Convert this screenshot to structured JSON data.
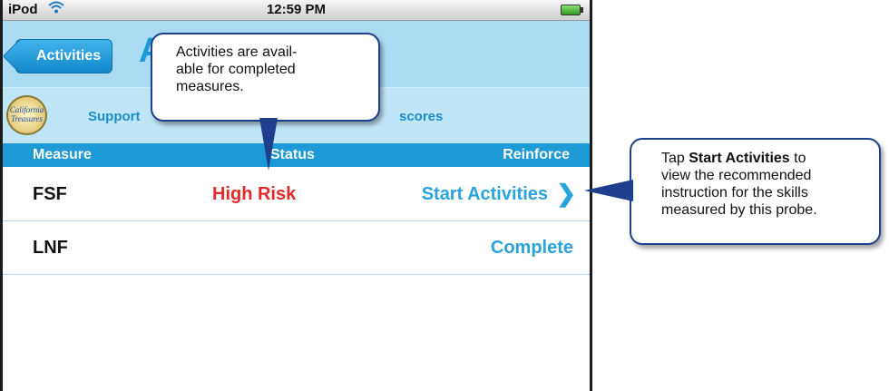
{
  "status_bar": {
    "carrier": "iPod",
    "time": "12:59 PM"
  },
  "nav": {
    "back_label": "Activities",
    "title_partial": "A"
  },
  "info_bar": {
    "logo_line1": "California",
    "logo_line2": "Treasures",
    "support_text": "Support",
    "scores_text": "scores"
  },
  "table": {
    "headers": {
      "measure": "Measure",
      "status": "Status",
      "reinforce": "Reinforce"
    },
    "rows": [
      {
        "measure": "FSF",
        "status": "High Risk",
        "action": "Start Activities"
      },
      {
        "measure": "LNF",
        "status": "",
        "action": "Complete"
      }
    ]
  },
  "callout_top": {
    "text": "Activities are available for completed measures.",
    "line1": "Activities are avail-",
    "line2": "able for completed",
    "line3": "measures."
  },
  "callout_right": {
    "prefix": "Tap",
    "bold": "Start Activities",
    "suffix_line1": "to",
    "line2": "view the recommended",
    "line3": "instruction for the skills",
    "line4": "measured by this probe."
  },
  "colors": {
    "accent": "#1e9ad6",
    "risk": "#e32a2a",
    "callout_border": "#1d3f8e"
  }
}
